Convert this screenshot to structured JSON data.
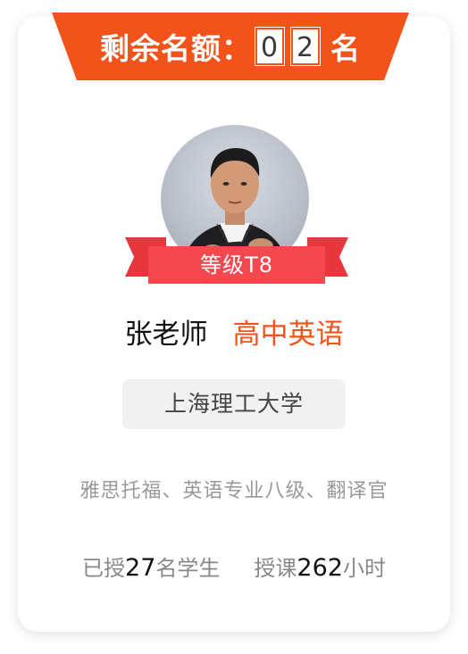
{
  "quota": {
    "label": "剩余名额：",
    "digits": [
      "0",
      "2"
    ],
    "unit": "名"
  },
  "teacher": {
    "level_badge": "等级T8",
    "name": "张老师",
    "subject": "高中英语",
    "school": "上海理工大学",
    "qualifications": "雅思托福、英语专业八级、翻译官"
  },
  "stats": {
    "students_prefix": "已授",
    "students_count": "27",
    "students_suffix": "名学生",
    "hours_prefix": "授课",
    "hours_count": "262",
    "hours_suffix": "小时"
  },
  "colors": {
    "accent_orange": "#f2531a",
    "ribbon_red": "#f4484e",
    "pill_bg": "#f1f1f1"
  }
}
